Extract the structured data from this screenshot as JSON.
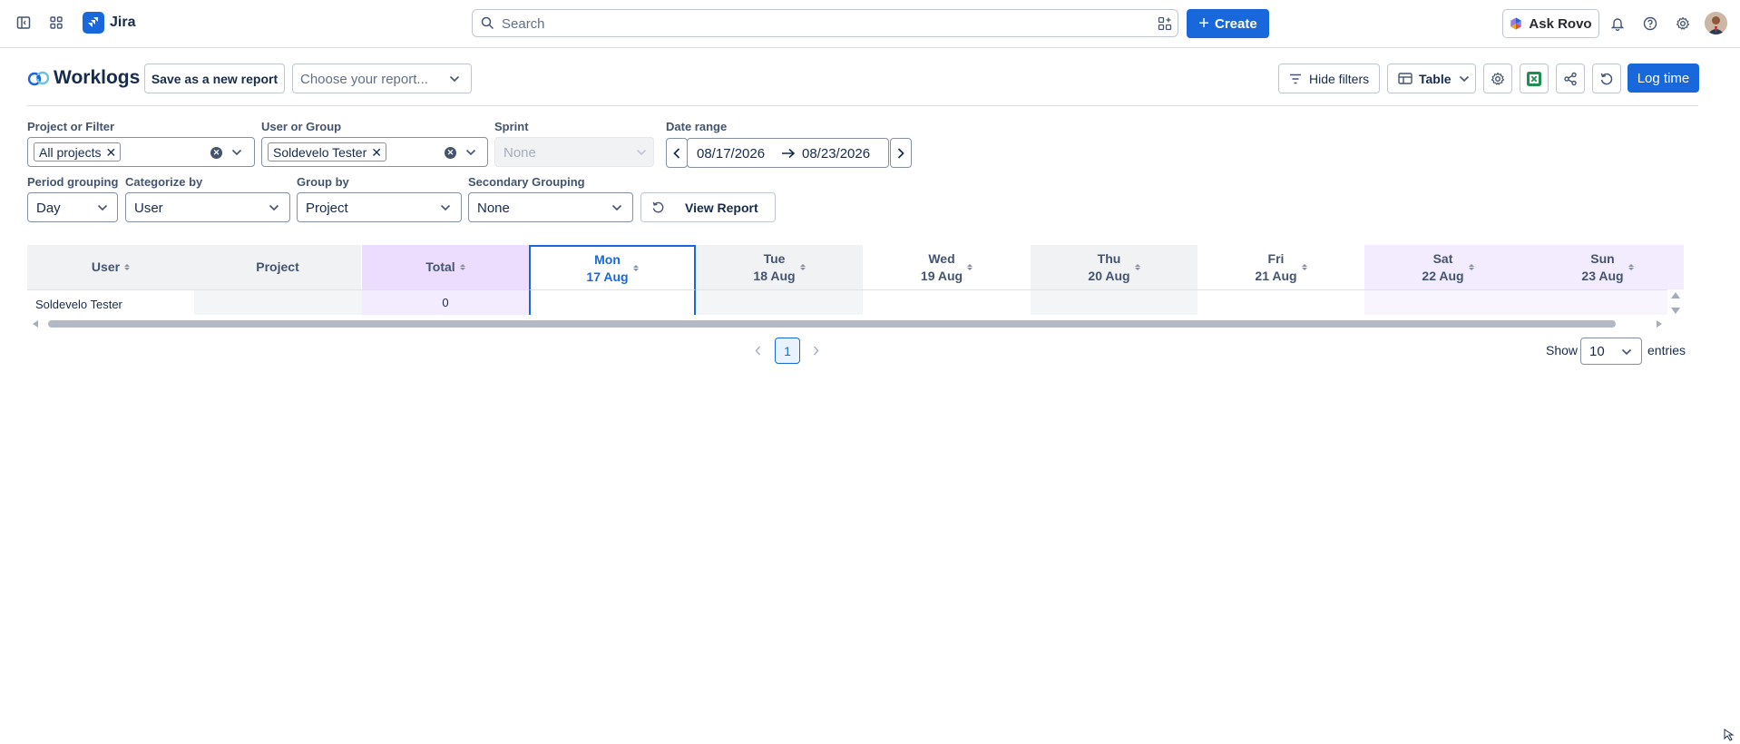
{
  "nav": {
    "app_name": "Jira",
    "search_placeholder": "Search",
    "create_label": "Create",
    "ask_rovo_label": "Ask Rovo"
  },
  "header": {
    "title": "Worklogs",
    "save_report_label": "Save as a new report",
    "choose_report_placeholder": "Choose your report...",
    "hide_filters_label": "Hide filters",
    "view_mode_label": "Table",
    "log_time_label": "Log time"
  },
  "filters": {
    "project_label": "Project or Filter",
    "project_chip": "All projects",
    "user_label": "User or Group",
    "user_chip": "Soldevelo Tester",
    "sprint_label": "Sprint",
    "sprint_value": "None",
    "date_range_label": "Date range",
    "date_from": "08/17/2026",
    "date_to": "08/23/2026",
    "period_label": "Period grouping",
    "period_value": "Day",
    "categorize_label": "Categorize by",
    "categorize_value": "User",
    "group_label": "Group by",
    "group_value": "Project",
    "secondary_label": "Secondary Grouping",
    "secondary_value": "None",
    "view_report_label": "View Report"
  },
  "table": {
    "col_user": "User",
    "col_project": "Project",
    "col_total": "Total",
    "days": [
      {
        "day": "Mon",
        "date": "17 Aug"
      },
      {
        "day": "Tue",
        "date": "18 Aug"
      },
      {
        "day": "Wed",
        "date": "19 Aug"
      },
      {
        "day": "Thu",
        "date": "20 Aug"
      },
      {
        "day": "Fri",
        "date": "21 Aug"
      },
      {
        "day": "Sat",
        "date": "22 Aug"
      },
      {
        "day": "Sun",
        "date": "23 Aug"
      }
    ],
    "rows": [
      {
        "user": "Soldevelo Tester",
        "project": "",
        "total": "0"
      }
    ]
  },
  "pagination": {
    "current_page": "1",
    "show_label": "Show",
    "page_size": "10",
    "entries_label": "entries"
  },
  "colors": {
    "brand_blue": "#1868db",
    "total_column": "#ecdcfd",
    "weekend_column": "#f3ebfe",
    "header_grey": "#f1f2f4"
  }
}
